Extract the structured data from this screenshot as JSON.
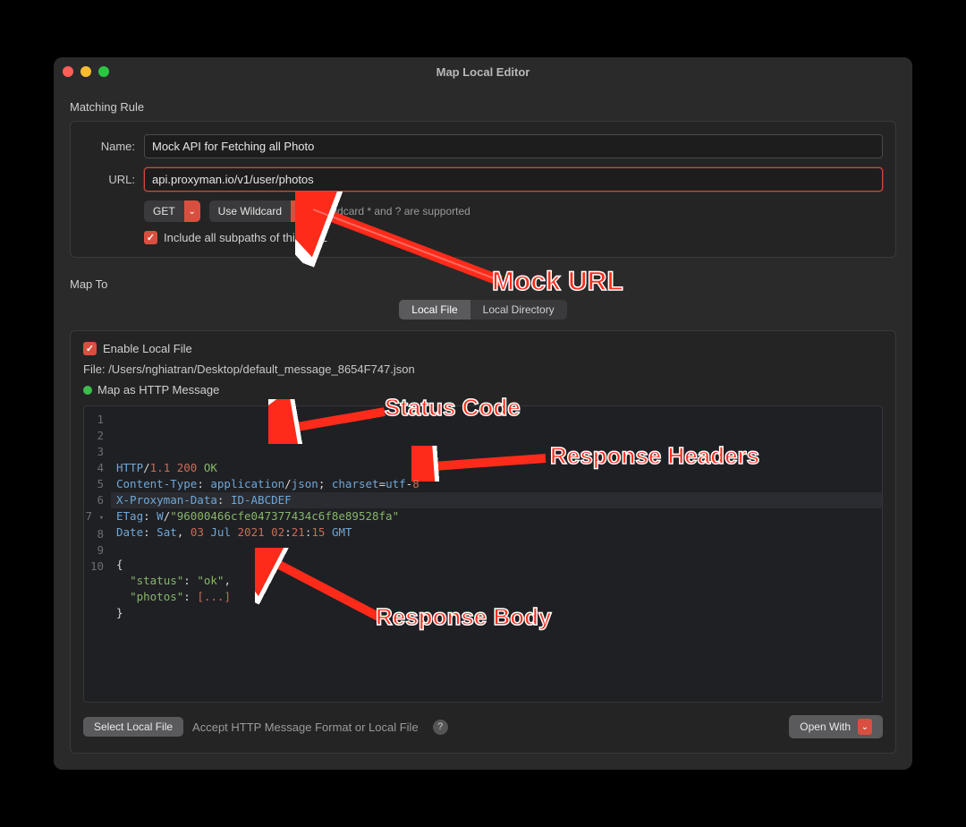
{
  "window": {
    "title": "Map Local Editor"
  },
  "matching": {
    "section_title": "Matching Rule",
    "name_label": "Name:",
    "name_value": "Mock API for Fetching all Photo",
    "url_label": "URL:",
    "url_value": "api.proxyman.io/v1/user/photos",
    "method": "GET",
    "wildcard_label": "Use Wildcard",
    "wildcard_hint": "wildcard * and ? are supported",
    "include_subpaths": "Include all subpaths of this URL"
  },
  "mapto": {
    "section_title": "Map To",
    "seg_local_file": "Local File",
    "seg_local_dir": "Local Directory",
    "enable_local_file": "Enable Local File",
    "file_label": "File:",
    "file_path": "/Users/nghiatran/Desktop/default_message_8654F747.json",
    "map_msg_label": "Map as HTTP Message"
  },
  "editor": {
    "gutter": [
      "1",
      "2",
      "3",
      "4",
      "5",
      "6",
      "7",
      "8",
      "9",
      "10"
    ],
    "line7_marker": "▾"
  },
  "http": {
    "proto": "HTTP",
    "ver": "1.1",
    "code": "200",
    "reason": "OK",
    "content_type_key": "Content-Type",
    "content_type_val1": "application",
    "content_type_val2": "json",
    "charset_key": "charset",
    "charset_val": "utf",
    "charset_num": "8",
    "x_header_key": "X-Proxyman-Data",
    "x_header_val": "ID-ABCDEF",
    "etag_key": "ETag",
    "etag_prefix": "W",
    "etag_val": "\"96000466cfe047377434c6f8e89528fa\"",
    "date_key": "Date",
    "date_day": "Sat",
    "date_daynum": "03",
    "date_month": "Jul",
    "date_year": "2021",
    "date_h": "02",
    "date_m": "21",
    "date_s": "15",
    "date_tz": "GMT",
    "body_status_key": "\"status\"",
    "body_status_val": "\"ok\"",
    "body_photos_key": "\"photos\"",
    "body_photos_val": "[...]"
  },
  "bottom": {
    "select_file": "Select Local File",
    "hint": "Accept HTTP Message Format or Local File",
    "open_with": "Open With"
  },
  "annotations": {
    "mock_url": "Mock URL",
    "status_code": "Status Code",
    "response_headers": "Response Headers",
    "response_body": "Response Body"
  }
}
